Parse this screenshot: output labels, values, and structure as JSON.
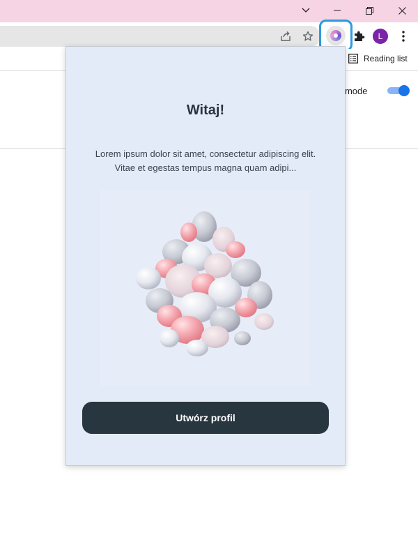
{
  "browser": {
    "avatar_letter": "L",
    "reading_list_label": "Reading list",
    "accent_color": "#2e9bdc",
    "avatar_color": "#7b24a6",
    "titlebar_color": "#f6d4e4"
  },
  "page": {
    "mode_label": "r mode",
    "toggle_on": true
  },
  "popup": {
    "title": "Witaj!",
    "description": "Lorem ipsum dolor sit amet, consectetur adipiscing elit. Vitae et egestas tempus magna quam adipi...",
    "cta_label": "Utwórz profil",
    "background_color": "#e3eaf8",
    "cta_color": "#283640"
  },
  "icons": [
    "tab-search-icon",
    "minimize-icon",
    "restore-icon",
    "close-icon",
    "share-icon",
    "star-icon",
    "extension-logo-icon",
    "puzzle-icon",
    "kebab-menu-icon",
    "reading-list-icon"
  ]
}
